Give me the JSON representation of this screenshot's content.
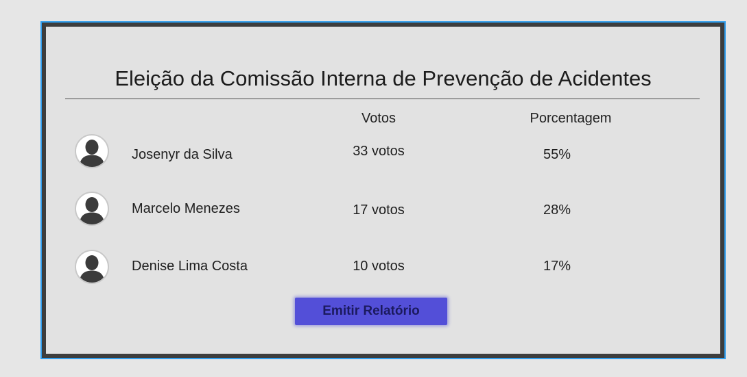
{
  "title": "Eleição da Comissão Interna de Prevenção de Acidentes",
  "columns": {
    "votes": "Votos",
    "percentage": "Porcentagem"
  },
  "candidates": [
    {
      "name": "Josenyr da Silva",
      "votes": "33 votos",
      "percentage": "55%"
    },
    {
      "name": "Marcelo Menezes",
      "votes": "17 votos",
      "percentage": "28%"
    },
    {
      "name": "Denise Lima Costa",
      "votes": "10 votos",
      "percentage": "17%"
    }
  ],
  "avatar_icon": "user-silhouette-icon",
  "report_button": "Emitir Relatório",
  "colors": {
    "window_border": "#2f9ded",
    "frame": "#3d3d3d",
    "panel": "#e2e2e2",
    "button": "#534fd8",
    "button_text": "#1b1a5e"
  }
}
